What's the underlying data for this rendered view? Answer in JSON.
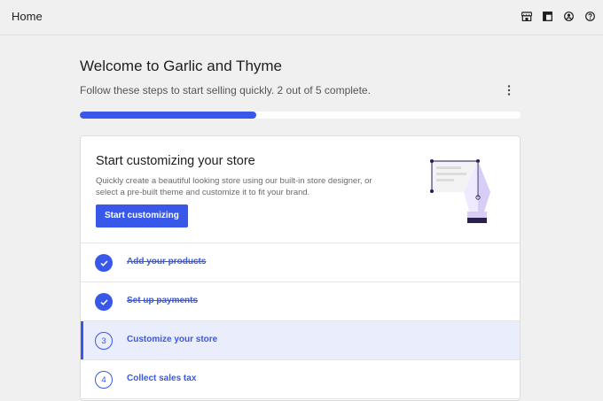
{
  "header": {
    "title": "Home",
    "icons": [
      "store-icon",
      "layout-icon",
      "account-icon",
      "help-icon"
    ]
  },
  "main": {
    "welcome_title": "Welcome to Garlic and Thyme",
    "progress_text": "Follow these steps to start selling quickly. 2 out of 5 complete.",
    "progress": {
      "completed": 2,
      "total": 5,
      "fraction": 0.4
    },
    "colors": {
      "accent": "#3858e9",
      "active_row": "#eaedfc",
      "illustration": "#d8cdf5"
    }
  },
  "hero": {
    "title": "Start customizing your store",
    "description": "Quickly create a beautiful looking store using our built-in store designer, or select a pre-built theme and customize it to fit your brand.",
    "cta_label": "Start customizing"
  },
  "tasks": [
    {
      "number": "1",
      "label": "Add your products",
      "status": "done"
    },
    {
      "number": "2",
      "label": "Set up payments",
      "status": "done"
    },
    {
      "number": "3",
      "label": "Customize your store",
      "status": "active"
    },
    {
      "number": "4",
      "label": "Collect sales tax",
      "status": "todo"
    }
  ]
}
